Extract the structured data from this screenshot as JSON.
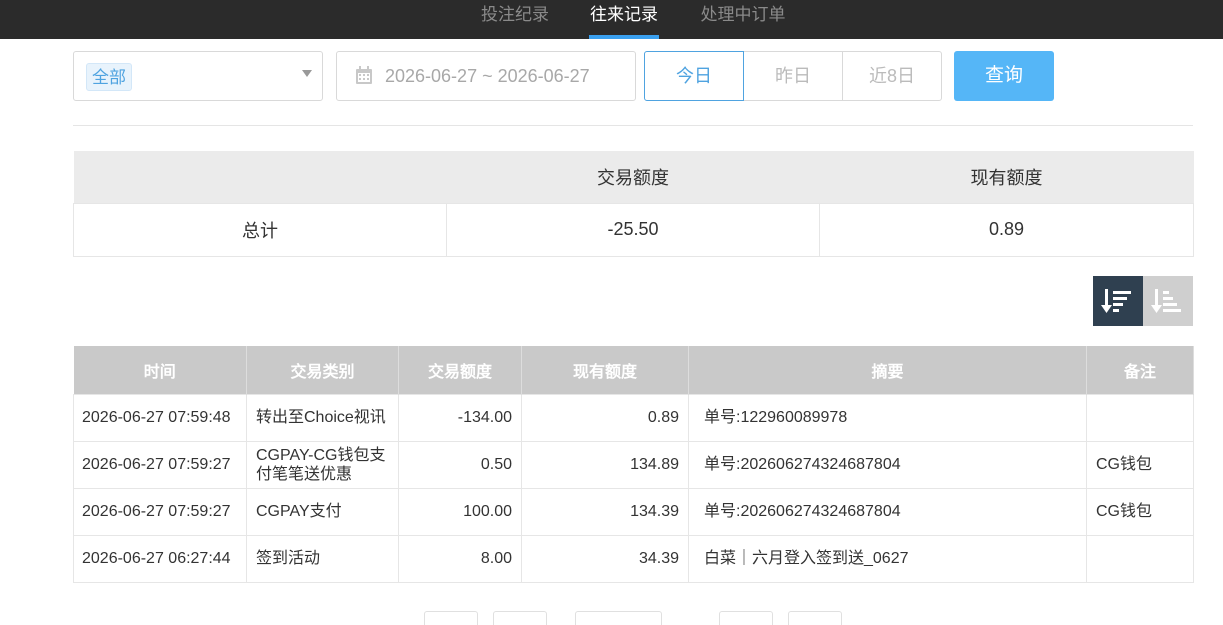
{
  "tabs": [
    {
      "label": "投注纪录",
      "active": false
    },
    {
      "label": "往来记录",
      "active": true
    },
    {
      "label": "处理中订单",
      "active": false
    }
  ],
  "filters": {
    "category_tag": "全部",
    "date_range": "2026-06-27 ~ 2026-06-27",
    "quick_buttons": [
      "今日",
      "昨日",
      "近8日"
    ],
    "query_label": "查询"
  },
  "summary": {
    "headers": [
      "",
      "交易额度",
      "现有额度"
    ],
    "row": {
      "label": "总计",
      "amount": "-25.50",
      "balance": "0.89"
    }
  },
  "sort": {
    "desc_icon": "sort-desc-icon",
    "asc_icon": "sort-asc-icon"
  },
  "records": {
    "headers": [
      "时间",
      "交易类别",
      "交易额度",
      "现有额度",
      "摘要",
      "备注"
    ],
    "rows": [
      {
        "time": "2026-06-27 07:59:48",
        "category": "转出至Choice视讯",
        "amount": "-134.00",
        "balance": "0.89",
        "summary": "单号:122960089978",
        "note": ""
      },
      {
        "time": "2026-06-27 07:59:27",
        "category": "CGPAY-CG钱包支付笔笔送优惠",
        "amount": "0.50",
        "balance": "134.89",
        "summary": "单号:202606274324687804",
        "note": "CG钱包"
      },
      {
        "time": "2026-06-27 07:59:27",
        "category": "CGPAY支付",
        "amount": "100.00",
        "balance": "134.39",
        "summary": "单号:202606274324687804",
        "note": "CG钱包"
      },
      {
        "time": "2026-06-27 06:27:44",
        "category": "签到活动",
        "amount": "8.00",
        "balance": "34.39",
        "summary": "白菜｜六月登入签到送_0627",
        "note": ""
      }
    ]
  },
  "colors": {
    "accent": "#55b6f7",
    "topbar": "#2b2b2b",
    "sort_active": "#2f4050"
  }
}
